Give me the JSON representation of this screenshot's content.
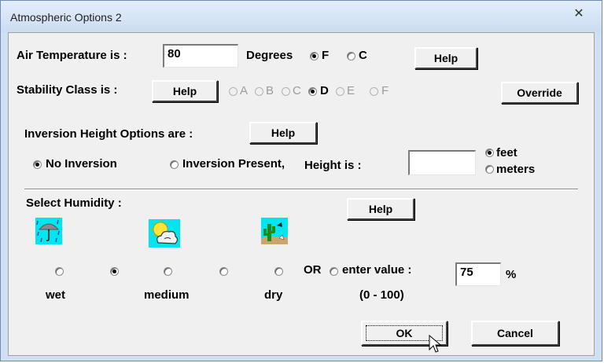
{
  "window": {
    "title": "Atmospheric Options 2",
    "close_glyph": "✕"
  },
  "temperature": {
    "label": "Air Temperature is :",
    "value": "80",
    "degrees_label": "Degrees",
    "unit_f": "F",
    "unit_c": "C",
    "selected_unit": "F",
    "help_label": "Help"
  },
  "stability": {
    "label": "Stability Class is :",
    "help_label": "Help",
    "classes": [
      "A",
      "B",
      "C",
      "D",
      "E",
      "F"
    ],
    "selected_class": "D",
    "override_label": "Override"
  },
  "inversion": {
    "label": "Inversion Height Options are :",
    "help_label": "Help",
    "no_inversion_label": "No Inversion",
    "present_label": "Inversion Present,",
    "height_label": "Height is :",
    "height_value": "",
    "unit_feet": "feet",
    "unit_meters": "meters",
    "selected_option": "No Inversion",
    "selected_unit": "feet"
  },
  "humidity": {
    "label": "Select Humidity :",
    "help_label": "Help",
    "icons": [
      "umbrella-rain-icon",
      "sun-cloud-icon",
      "cactus-desert-icon"
    ],
    "wet_label": "wet",
    "medium_label": "medium",
    "dry_label": "dry",
    "or_label": "OR",
    "enter_label": "enter value :",
    "value": "75",
    "percent": "%",
    "range": "(0 - 100)",
    "selected_index": 1
  },
  "buttons": {
    "ok_label": "OK",
    "cancel_label": "Cancel"
  }
}
